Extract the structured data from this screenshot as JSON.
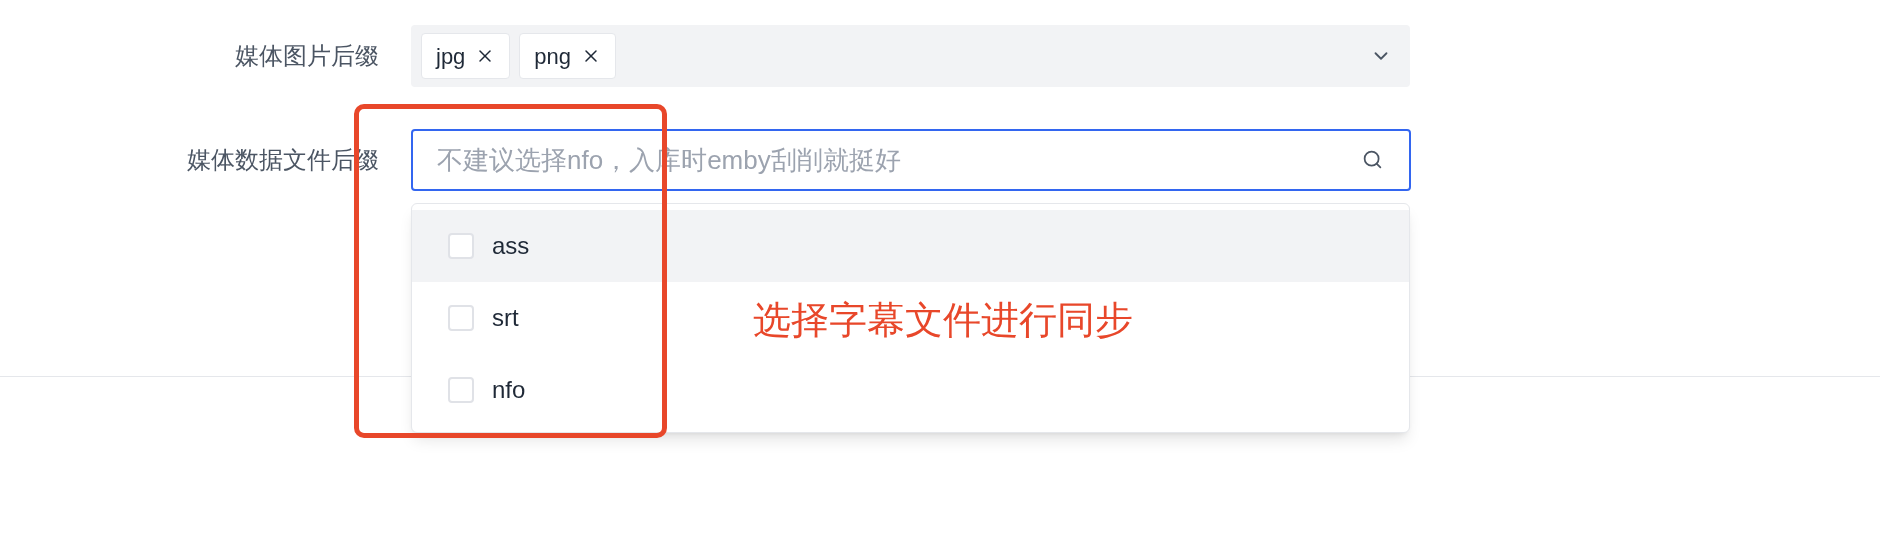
{
  "fields": [
    {
      "kind": "tags",
      "label": "媒体图片后缀",
      "tags": [
        "jpg",
        "png"
      ]
    },
    {
      "kind": "search",
      "label": "媒体数据文件后缀",
      "placeholder": "不建议选择nfo，入库时emby刮削就挺好",
      "focused": true
    }
  ],
  "dropdown": {
    "options": [
      {
        "label": "ass",
        "checked": false,
        "highlighted": true
      },
      {
        "label": "srt",
        "checked": false,
        "highlighted": false
      },
      {
        "label": "nfo",
        "checked": false,
        "highlighted": false
      }
    ]
  },
  "annotation": {
    "text": "选择字幕文件进行同步",
    "color": "#e8472a"
  }
}
